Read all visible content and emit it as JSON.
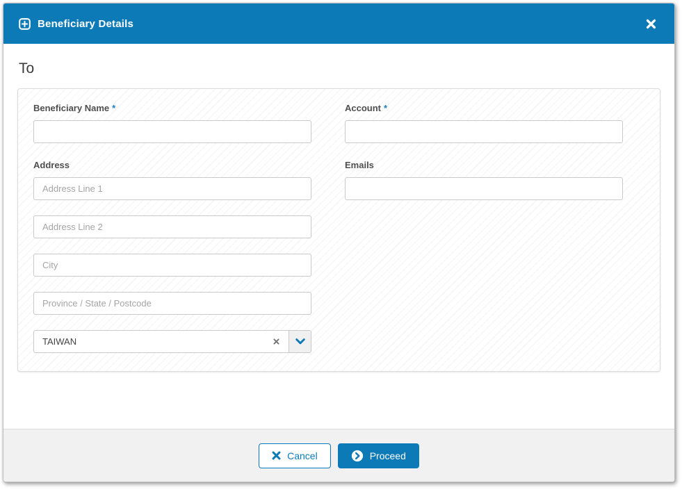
{
  "header": {
    "title": "Beneficiary Details"
  },
  "section": {
    "to_heading": "To"
  },
  "form": {
    "required_marker": "*",
    "beneficiary_name": {
      "label": "Beneficiary Name",
      "value": "",
      "required": true
    },
    "account": {
      "label": "Account",
      "value": "",
      "required": true
    },
    "address": {
      "label": "Address",
      "line1": {
        "placeholder": "Address Line 1",
        "value": ""
      },
      "line2": {
        "placeholder": "Address Line 2",
        "value": ""
      },
      "city": {
        "placeholder": "City",
        "value": ""
      },
      "province": {
        "placeholder": "Province / State / Postcode",
        "value": ""
      }
    },
    "emails": {
      "label": "Emails",
      "value": ""
    },
    "country": {
      "value": "TAIWAN"
    }
  },
  "footer": {
    "cancel_label": "Cancel",
    "proceed_label": "Proceed"
  },
  "icons": {
    "header_icon": "plus-square-icon",
    "close_icon": "close-x-icon",
    "country_clear_icon": "clear-x-icon",
    "country_dropdown_icon": "chevron-down-icon",
    "cancel_icon": "x-icon",
    "proceed_icon": "chevron-right-circle-icon"
  },
  "colors": {
    "accent_blue": "#0d7ab8",
    "header_bg": "#0d7ab8",
    "footer_bg": "#f1f1f1",
    "label_text": "#4f4f4f",
    "placeholder_text": "#a5a5a5",
    "input_border": "#c9c9c9"
  }
}
